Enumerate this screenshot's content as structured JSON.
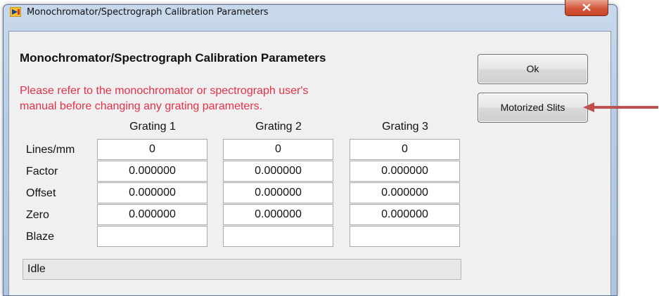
{
  "window": {
    "title": "Monochromator/Spectrograph Calibration Parameters",
    "close_label": "x"
  },
  "dialog": {
    "heading": "Monochromator/Spectrograph Calibration Parameters",
    "warning_line1": "Please refer to the monochromator or spectrograph user's",
    "warning_line2": "manual before changing any grating parameters.",
    "warning_color": "#e8304a"
  },
  "buttons": {
    "ok_label": "Ok",
    "motorized_slits_label": "Motorized Slits"
  },
  "table": {
    "columns": [
      "Grating 1",
      "Grating 2",
      "Grating 3"
    ],
    "rows": [
      {
        "label": "Lines/mm",
        "values": [
          "0",
          "0",
          "0"
        ]
      },
      {
        "label": "Factor",
        "values": [
          "0.000000",
          "0.000000",
          "0.000000"
        ]
      },
      {
        "label": "Offset",
        "values": [
          "0.000000",
          "0.000000",
          "0.000000"
        ]
      },
      {
        "label": "Zero",
        "values": [
          "0.000000",
          "0.000000",
          "0.000000"
        ]
      },
      {
        "label": "Blaze",
        "values": [
          "",
          "",
          ""
        ]
      }
    ]
  },
  "status": {
    "text": "Idle"
  },
  "annotation": {
    "arrow_color": "#c0504d"
  }
}
